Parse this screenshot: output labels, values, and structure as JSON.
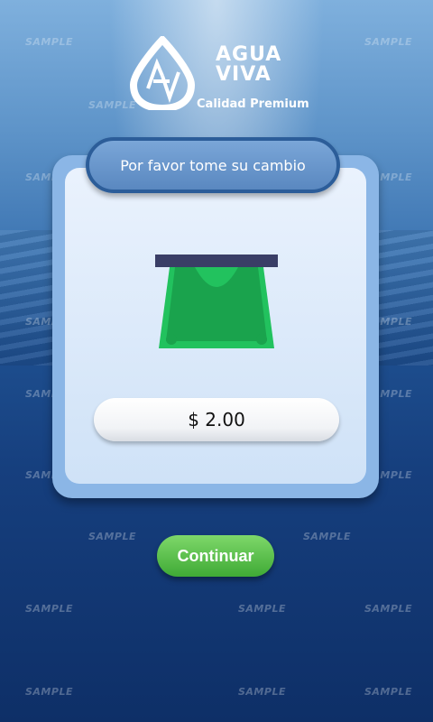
{
  "logo": {
    "brand_line1": "AGUA",
    "brand_line2": "VIVA",
    "tagline": "Calidad Premium",
    "icon": "water-drop-logo-icon"
  },
  "panel": {
    "title": "Por favor tome su cambio",
    "amount": "$ 2.00",
    "money_icon": "cash-dispense-icon"
  },
  "actions": {
    "continue_label": "Continuar"
  },
  "watermark": "SAMPLE",
  "colors": {
    "panel_blue": "#8bb6e6",
    "header_border": "#2c5d99",
    "continue_green": "#3faa35"
  }
}
